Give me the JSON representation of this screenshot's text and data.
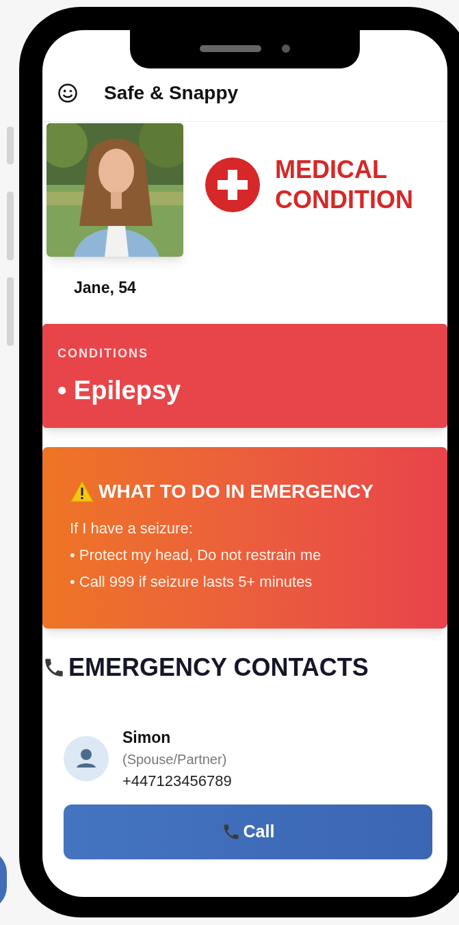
{
  "app": {
    "title": "Safe & Snappy"
  },
  "profile": {
    "name": "Jane, 54"
  },
  "banner": {
    "lines": [
      "MEDICAL",
      "CONDITION"
    ]
  },
  "conditions": {
    "label": "CONDITIONS",
    "items": [
      "• Epilepsy"
    ]
  },
  "emergency": {
    "title": "WHAT TO DO IN EMERGENCY",
    "lines": [
      "If I have a seizure:",
      "• Protect my head, Do not restrain me",
      "• Call 999 if seizure lasts 5+ minutes"
    ]
  },
  "contacts": {
    "title": "EMERGENCY CONTACTS",
    "items": [
      {
        "name": "Simon",
        "relation": "(Spouse/Partner)",
        "phone": "+447123456789",
        "button": "Call"
      }
    ]
  }
}
